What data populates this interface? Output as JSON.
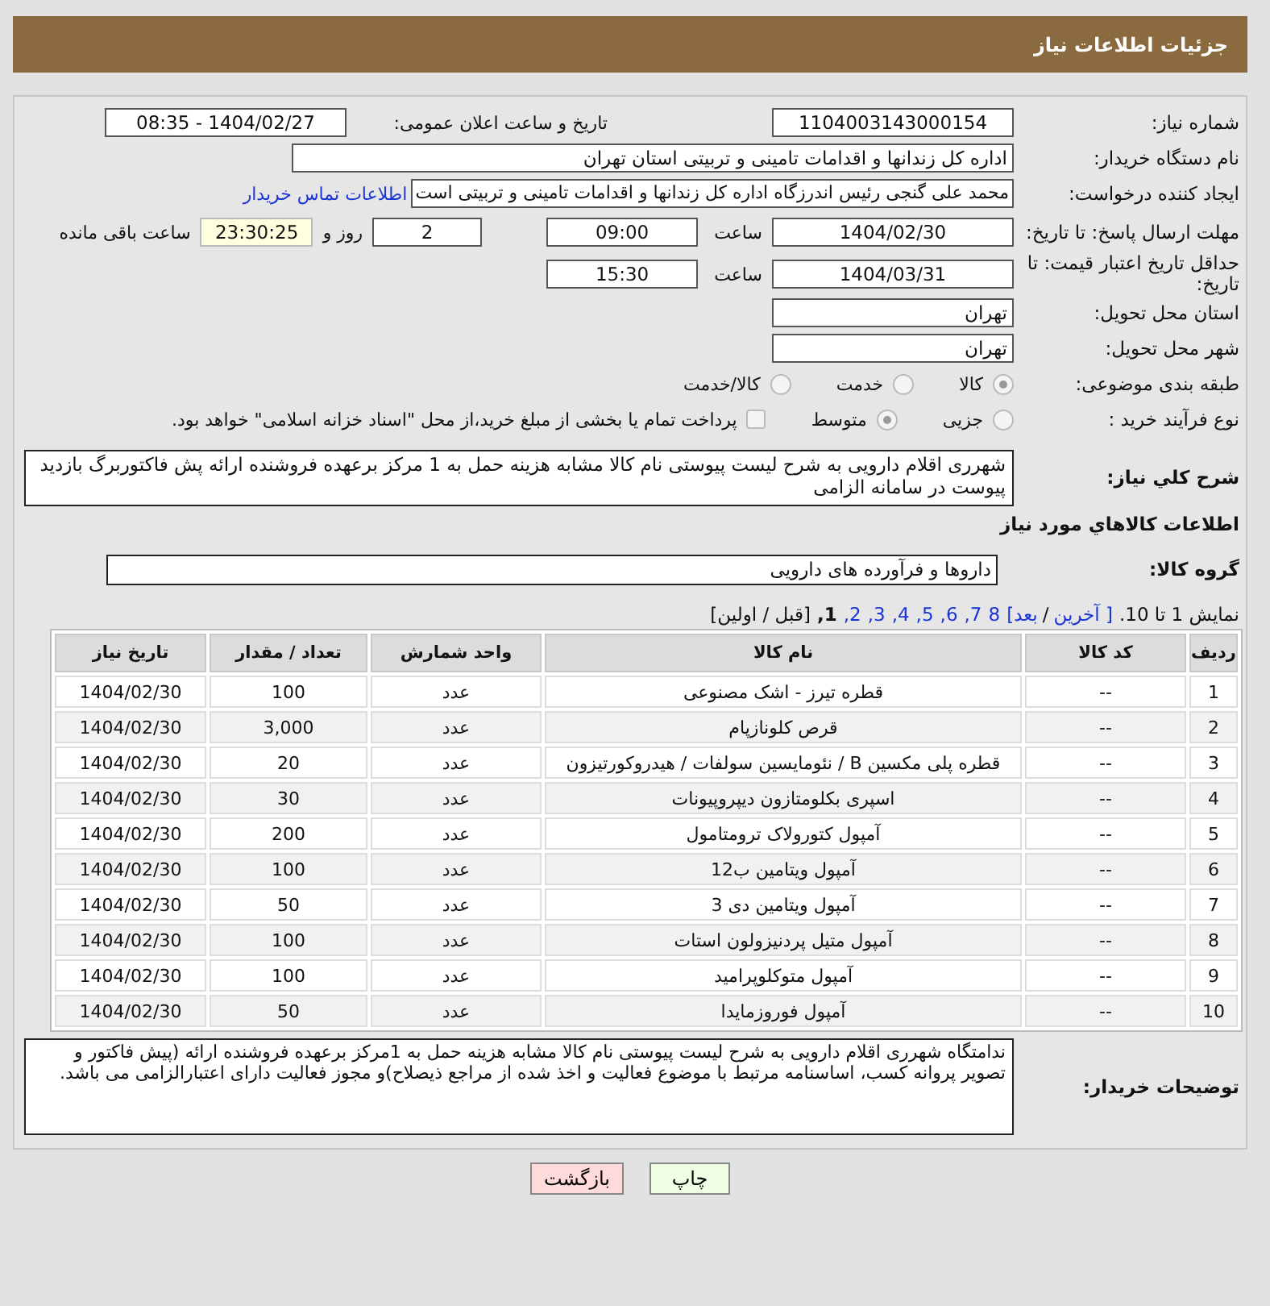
{
  "header": {
    "title": "جزئیات اطلاعات نیاز"
  },
  "fields": {
    "need_number": {
      "label": "شماره نیاز:",
      "value": "1104003143000154"
    },
    "announce": {
      "label": "تاریخ و ساعت اعلان عمومی:",
      "value": "1404/02/27 - 08:35"
    },
    "buyer_org": {
      "label": "نام دستگاه خریدار:",
      "value": "اداره کل زندانها و اقدامات تامینی و تربیتی استان تهران"
    },
    "requester": {
      "label": "ایجاد کننده درخواست:",
      "value": "محمد علی گنجی رئیس اندرزگاه  اداره کل زندانها و اقدامات تامینی و تربیتی است",
      "link": "اطلاعات تماس خریدار"
    },
    "deadline": {
      "label": "مهلت ارسال پاسخ: تا تاریخ:",
      "date": "1404/02/30",
      "time_label": "ساعت",
      "time": "09:00",
      "days": "2",
      "days_label": "روز و",
      "remaining": "23:30:25",
      "remaining_label": "ساعت باقی مانده"
    },
    "validity": {
      "label": "حداقل تاریخ اعتبار قیمت: تا تاریخ:",
      "date": "1404/03/31",
      "time_label": "ساعت",
      "time": "15:30"
    },
    "province": {
      "label": "استان محل تحویل:",
      "value": "تهران"
    },
    "city": {
      "label": "شهر محل تحویل:",
      "value": "تهران"
    }
  },
  "category": {
    "label": "طبقه بندی موضوعی:",
    "options": [
      {
        "label": "کالا",
        "selected": true
      },
      {
        "label": "خدمت",
        "selected": false
      },
      {
        "label": "کالا/خدمت",
        "selected": false
      }
    ]
  },
  "purchase_type": {
    "label": "نوع فرآیند خرید :",
    "options": [
      {
        "label": "جزیی",
        "selected": false
      },
      {
        "label": "متوسط",
        "selected": true
      }
    ],
    "treasury": {
      "checked": false,
      "text": "پرداخت تمام یا بخشی از مبلغ خرید،از محل \"اسناد خزانه اسلامی\" خواهد بود."
    }
  },
  "description": {
    "label": "شرح کلي نياز:",
    "value": "شهرری اقلام دارویی به شرح لیست پیوستی نام کالا مشابه هزینه حمل به 1 مرکز برعهده فروشنده ارائه پش فاکتوربرگ بازدید پیوست در سامانه الزامی"
  },
  "goods_heading": "اطلاعات کالاهاي مورد نياز",
  "goods_group": {
    "label": "گروه کالا:",
    "value": "داروها و فرآورده های دارویی"
  },
  "pagination": {
    "summary": "نمایش 1 تا 10.",
    "nav": [
      {
        "label": "[ آخرین"
      },
      {
        "label": "/"
      },
      {
        "label": "بعد]"
      }
    ],
    "pages": [
      {
        "label": "8",
        "selected": false
      },
      {
        "label": "7,",
        "selected": false
      },
      {
        "label": "6,",
        "selected": false
      },
      {
        "label": "5,",
        "selected": false
      },
      {
        "label": "4,",
        "selected": false
      },
      {
        "label": "3,",
        "selected": false
      },
      {
        "label": "2,",
        "selected": false
      },
      {
        "label": "1,",
        "selected": true
      }
    ],
    "prev": "[قبل / اولین]"
  },
  "table": {
    "columns": [
      "ردیف",
      "کد کالا",
      "نام کالا",
      "واحد شمارش",
      "تعداد / مقدار",
      "تاریخ نیاز"
    ],
    "rows": [
      [
        "1",
        "--",
        "قطره تیرز - اشک مصنوعی",
        "عدد",
        "100",
        "1404/02/30"
      ],
      [
        "2",
        "--",
        "قرص کلونازپام",
        "عدد",
        "3,000",
        "1404/02/30"
      ],
      [
        "3",
        "--",
        "قطره پلی مکسین B / نئومایسین سولفات / هیدروکورتیزون",
        "عدد",
        "20",
        "1404/02/30"
      ],
      [
        "4",
        "--",
        "اسپری بکلومتازون دیپروپیونات",
        "عدد",
        "30",
        "1404/02/30"
      ],
      [
        "5",
        "--",
        "آمپول کتورولاک ترومتامول",
        "عدد",
        "200",
        "1404/02/30"
      ],
      [
        "6",
        "--",
        "آمپول ویتامین ب12",
        "عدد",
        "100",
        "1404/02/30"
      ],
      [
        "7",
        "--",
        "آمپول ویتامین دی 3",
        "عدد",
        "50",
        "1404/02/30"
      ],
      [
        "8",
        "--",
        "آمپول متیل پردنیزولون استات",
        "عدد",
        "100",
        "1404/02/30"
      ],
      [
        "9",
        "--",
        "آمپول متوکلوپرامید",
        "عدد",
        "100",
        "1404/02/30"
      ],
      [
        "10",
        "--",
        "آمپول فوروزمایدا",
        "عدد",
        "50",
        "1404/02/30"
      ]
    ]
  },
  "buyer_notes": {
    "label": "توضیحات خریدار:",
    "value": "ندامتگاه شهرری اقلام دارویی به شرح لیست پیوستی نام کالا مشابه هزینه حمل به 1مرکز برعهده فروشنده ارائه (پیش فاکتور و  تصویر پروانه کسب، اساسنامه مرتبط با موضوع فعالیت و اخذ شده از مراجع ذیصلاح)و مجوز فعالیت دارای اعتبارالزامی می باشد."
  },
  "buttons": [
    {
      "label": "چاپ",
      "kind": "print"
    },
    {
      "label": "بازگشت",
      "kind": "back"
    }
  ]
}
